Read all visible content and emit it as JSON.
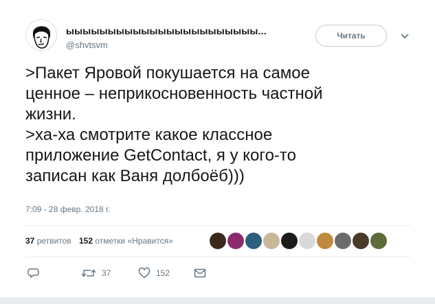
{
  "tweet": {
    "display_name": "ыыыыыыыыыыыыыыыыыыыыыыы...",
    "handle": "@shvtsvm",
    "follow_label": "Читать",
    "text_lines": [
      ">Пакет Яровой покушается на самое",
      "ценное – неприкосновенность частной",
      "жизни.",
      ">ха-ха смотрите какое классное",
      "приложение GetContact, я у кого-то",
      "записан как Ваня долбоёб)))"
    ],
    "timestamp": "7:09 - 28 февр. 2018 г.",
    "stats": {
      "retweets_count": "37",
      "retweets_label": "ретвитов",
      "likes_count": "152",
      "likes_label": "отметки «Нравится»"
    },
    "likers": [
      {
        "name": "liker-avatar-1",
        "color": "#3a2a1e"
      },
      {
        "name": "liker-avatar-2",
        "color": "#8b2b6e"
      },
      {
        "name": "liker-avatar-3",
        "color": "#2d5f7e"
      },
      {
        "name": "liker-avatar-4",
        "color": "#c9b79c"
      },
      {
        "name": "liker-avatar-5",
        "color": "#1c1c1c"
      },
      {
        "name": "liker-avatar-6",
        "color": "#d9d9d9"
      },
      {
        "name": "liker-avatar-7",
        "color": "#c08a3e"
      },
      {
        "name": "liker-avatar-8",
        "color": "#6b6b6b"
      },
      {
        "name": "liker-avatar-9",
        "color": "#4a3a2a"
      },
      {
        "name": "liker-avatar-10",
        "color": "#5e6b3a"
      }
    ],
    "actions": {
      "reply_icon": "reply-icon",
      "retweet_icon": "retweet-icon",
      "retweet_count": "37",
      "like_icon": "heart-icon",
      "like_count": "152",
      "dm_icon": "envelope-icon"
    }
  },
  "colors": {
    "text": "#14171a",
    "secondary": "#657786",
    "border": "#e6ecf0",
    "background": "#e6ecf0"
  }
}
